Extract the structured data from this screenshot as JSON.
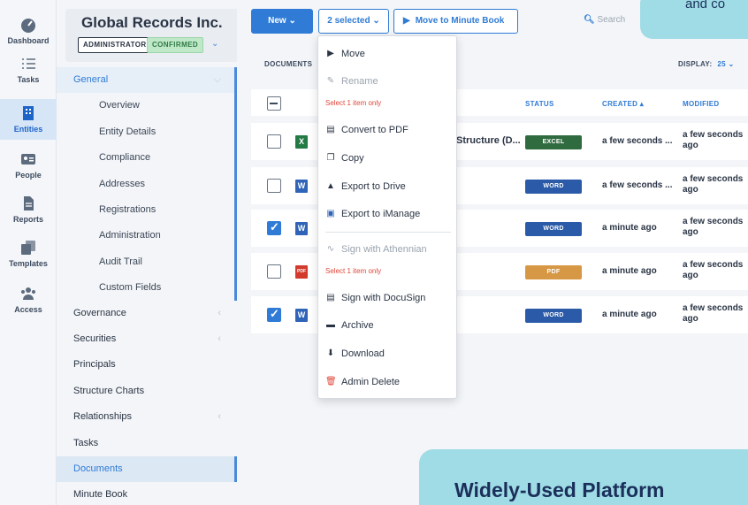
{
  "rail": {
    "items": [
      {
        "label": "Dashboard",
        "icon": "gauge-icon"
      },
      {
        "label": "Tasks",
        "icon": "checklist-icon"
      },
      {
        "label": "Entities",
        "icon": "building-icon"
      },
      {
        "label": "People",
        "icon": "id-card-icon"
      },
      {
        "label": "Reports",
        "icon": "document-icon"
      },
      {
        "label": "Templates",
        "icon": "copy-icon"
      },
      {
        "label": "Access",
        "icon": "users-icon"
      }
    ]
  },
  "entity": {
    "name": "Global Records Inc.",
    "role_badge": "ADMINISTRATOR",
    "status_badge": "CONFIRMED",
    "caret": "⌄"
  },
  "nav": {
    "items": [
      {
        "label": "General"
      },
      {
        "label": "Overview"
      },
      {
        "label": "Entity Details"
      },
      {
        "label": "Compliance"
      },
      {
        "label": "Addresses"
      },
      {
        "label": "Registrations"
      },
      {
        "label": "Administration"
      },
      {
        "label": "Audit Trail"
      },
      {
        "label": "Custom Fields"
      },
      {
        "label": "Governance"
      },
      {
        "label": "Securities"
      },
      {
        "label": "Principals"
      },
      {
        "label": "Structure Charts"
      },
      {
        "label": "Relationships"
      },
      {
        "label": "Tasks"
      },
      {
        "label": "Documents"
      },
      {
        "label": "Minute Book"
      }
    ]
  },
  "toolbar": {
    "new_label": "New ⌄",
    "selected_label": "2 selected ⌄",
    "move_label": "Move to Minute Book",
    "search_placeholder": "Search"
  },
  "documents": {
    "section_label": "DOCUMENTS",
    "display_label": "DISPLAY:",
    "display_value": "25 ⌄",
    "columns": {
      "status": "STATUS",
      "created": "CREATED ▴",
      "modified": "MODIFIED"
    },
    "rows": [
      {
        "type": "X",
        "name": "Structure (D...",
        "status": "EXCEL",
        "created": "a few seconds ...",
        "modified": "a few seconds ago",
        "checked": false
      },
      {
        "type": "W",
        "name": "",
        "status": "WORD",
        "created": "a few seconds ...",
        "modified": "a few seconds ago",
        "checked": false
      },
      {
        "type": "W",
        "name": "",
        "status": "WORD",
        "created": "a minute ago",
        "modified": "a few seconds ago",
        "checked": true
      },
      {
        "type": "PDF",
        "name": "",
        "status": "PDF",
        "created": "a minute ago",
        "modified": "a few seconds ago",
        "checked": false
      },
      {
        "type": "W",
        "name": "",
        "status": "WORD",
        "created": "a minute ago",
        "modified": "a few seconds ago",
        "checked": true
      }
    ]
  },
  "menu": {
    "items": [
      {
        "label": "Move",
        "icon": "move-icon"
      },
      {
        "label": "Rename",
        "icon": "pencil-icon"
      },
      {
        "label": "Convert to PDF",
        "icon": "pdf-file-icon"
      },
      {
        "label": "Copy",
        "icon": "copy-icon"
      },
      {
        "label": "Export to Drive",
        "icon": "drive-icon"
      },
      {
        "label": "Export to iManage",
        "icon": "imanage-icon"
      },
      {
        "label": "Sign with Athennian",
        "icon": "signature-icon"
      },
      {
        "label": "Sign with DocuSign",
        "icon": "docusign-icon"
      },
      {
        "label": "Archive",
        "icon": "archive-icon"
      },
      {
        "label": "Download",
        "icon": "download-icon"
      },
      {
        "label": "Admin Delete",
        "icon": "trash-icon"
      }
    ],
    "note_rename": "Select 1 item only",
    "note_sign": "Select 1 item only"
  },
  "marketing": {
    "top_text": "and co",
    "banner_text": "Widely-Used Platform"
  }
}
